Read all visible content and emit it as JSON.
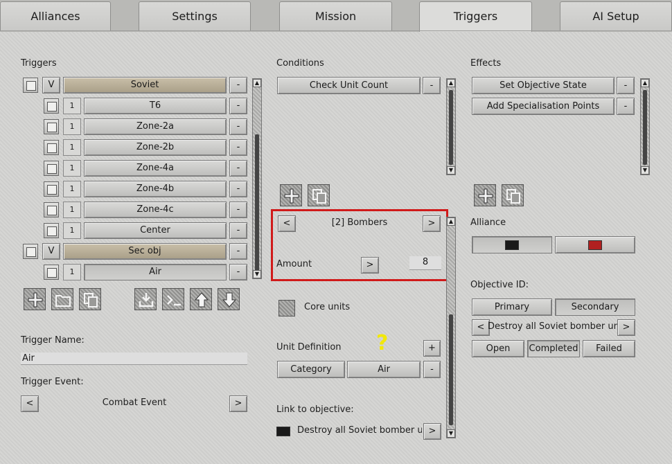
{
  "tabs": [
    "Alliances",
    "Settings",
    "Mission",
    "Triggers",
    "AI Setup"
  ],
  "active_tab": "Triggers",
  "triggers": {
    "title": "Triggers",
    "remove_label": "-",
    "items": [
      {
        "level": 0,
        "tag": "V",
        "name": "Soviet",
        "selected": true
      },
      {
        "level": 1,
        "tag": "1",
        "name": "T6"
      },
      {
        "level": 1,
        "tag": "1",
        "name": "Zone-2a"
      },
      {
        "level": 1,
        "tag": "1",
        "name": "Zone-2b"
      },
      {
        "level": 1,
        "tag": "1",
        "name": "Zone-4a"
      },
      {
        "level": 1,
        "tag": "1",
        "name": "Zone-4b"
      },
      {
        "level": 1,
        "tag": "1",
        "name": "Zone-4c"
      },
      {
        "level": 1,
        "tag": "1",
        "name": "Center"
      },
      {
        "level": 0,
        "tag": "V",
        "name": "Sec obj",
        "selected": true
      },
      {
        "level": 1,
        "tag": "1",
        "name": "Air",
        "pressed": true
      }
    ],
    "trigger_name_label": "Trigger Name:",
    "trigger_name_value": "Air",
    "trigger_event_label": "Trigger Event:",
    "trigger_event_value": "Combat Event",
    "prev": "<",
    "next": ">"
  },
  "conditions": {
    "title": "Conditions",
    "items": [
      "Check Unit Count"
    ],
    "remove_label": "-",
    "selector_prev": "<",
    "selector_value": "[2] Bombers",
    "selector_next": ">",
    "amount_label": "Amount",
    "amount_btn": ">",
    "amount_value": "8",
    "core_units_label": "Core units",
    "unit_def_label": "Unit Definition",
    "unit_def_add": "+",
    "unit_def_category": "Category",
    "unit_def_value": "Air",
    "unit_def_remove": "-",
    "annotation": "?",
    "link_label": "Link to objective:",
    "link_value": "Destroy all Soviet bomber units",
    "link_next": ">"
  },
  "effects": {
    "title": "Effects",
    "items": [
      "Set Objective State",
      "Add Specialisation Points"
    ],
    "remove_label": "-",
    "alliance_label": "Alliance",
    "objective_id_label": "Objective ID:",
    "primary": "Primary",
    "secondary": "Secondary",
    "objective_prev": "<",
    "objective_value": "Destroy all Soviet bomber units",
    "objective_next": ">",
    "states": [
      "Open",
      "Completed",
      "Failed"
    ],
    "active_state": "Completed"
  },
  "colors": {
    "selected_row": "#b9af97",
    "highlight_box": "#d01a1a",
    "annotation": "#f2e80a",
    "alliance_black": "#1a1a1a",
    "alliance_red": "#b02020"
  }
}
